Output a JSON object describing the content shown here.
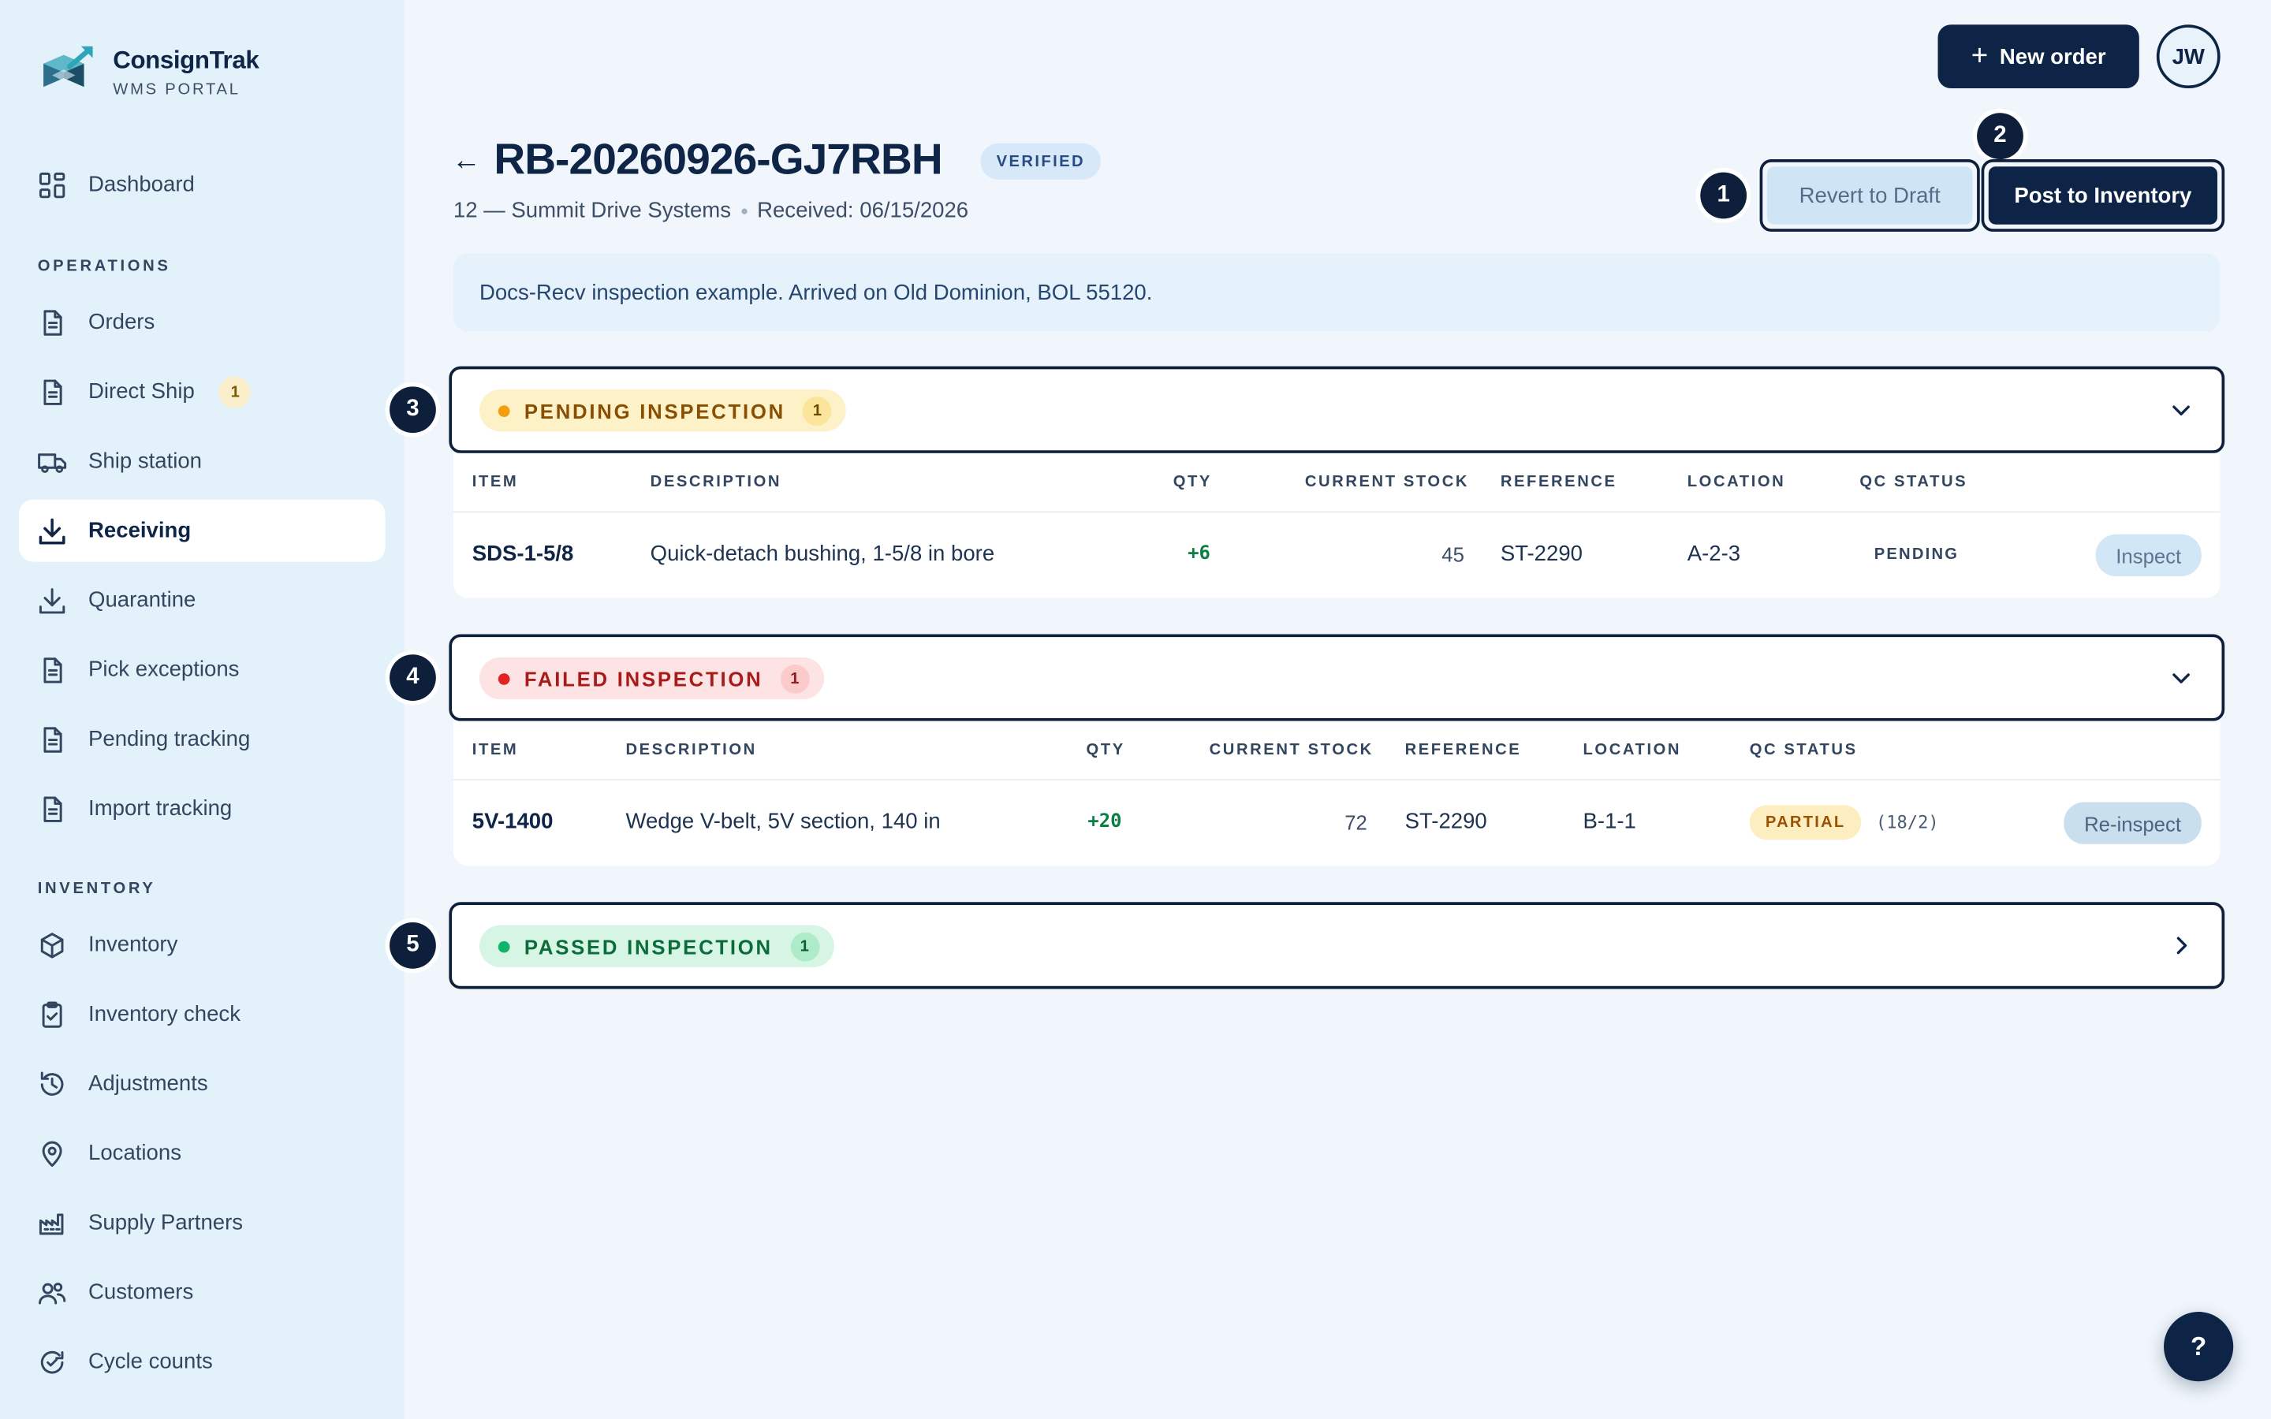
{
  "brand": {
    "name": "ConsignTrak",
    "subtitle": "WMS PORTAL"
  },
  "sidebar": {
    "dashboard": "Dashboard",
    "operations_label": "OPERATIONS",
    "operations": [
      {
        "label": "Orders",
        "icon": "document-icon"
      },
      {
        "label": "Direct Ship",
        "icon": "document-icon",
        "badge": "1"
      },
      {
        "label": "Ship station",
        "icon": "truck-icon"
      },
      {
        "label": "Receiving",
        "icon": "download-icon",
        "active": true
      },
      {
        "label": "Quarantine",
        "icon": "download-icon"
      },
      {
        "label": "Pick exceptions",
        "icon": "document-icon"
      },
      {
        "label": "Pending tracking",
        "icon": "document-icon"
      },
      {
        "label": "Import tracking",
        "icon": "document-icon"
      }
    ],
    "inventory_label": "INVENTORY",
    "inventory": [
      {
        "label": "Inventory",
        "icon": "box-icon"
      },
      {
        "label": "Inventory check",
        "icon": "clipboard-check-icon"
      },
      {
        "label": "Adjustments",
        "icon": "history-icon"
      },
      {
        "label": "Locations",
        "icon": "map-pin-icon"
      },
      {
        "label": "Supply Partners",
        "icon": "factory-icon"
      },
      {
        "label": "Customers",
        "icon": "users-icon"
      },
      {
        "label": "Cycle counts",
        "icon": "refresh-check-icon"
      }
    ]
  },
  "topbar": {
    "new_order": "New order",
    "avatar": "JW"
  },
  "header": {
    "title": "RB-20260926-GJ7RBH",
    "status": "VERIFIED",
    "customer": "12 — Summit Drive Systems",
    "received": "Received: 06/15/2026",
    "revert_label": "Revert to Draft",
    "post_label": "Post to Inventory"
  },
  "markers": [
    "1",
    "2",
    "3",
    "4",
    "5"
  ],
  "note": "Docs-Recv inspection example. Arrived on Old Dominion, BOL 55120.",
  "columns": {
    "item": "ITEM",
    "description": "DESCRIPTION",
    "qty": "QTY",
    "stock": "CURRENT STOCK",
    "reference": "REFERENCE",
    "location": "LOCATION",
    "qc": "QC STATUS"
  },
  "sections": {
    "pending": {
      "label": "PENDING INSPECTION",
      "count": "1",
      "row": {
        "item": "SDS-1-5/8",
        "description": "Quick-detach bushing, 1-5/8 in bore",
        "qty": "+6",
        "stock": "45",
        "reference": "ST-2290",
        "location": "A-2-3",
        "qc": "PENDING",
        "action": "Inspect"
      }
    },
    "failed": {
      "label": "FAILED INSPECTION",
      "count": "1",
      "row": {
        "item": "5V-1400",
        "description": "Wedge V-belt, 5V section, 140 in",
        "qty": "+20",
        "stock": "72",
        "reference": "ST-2290",
        "location": "B-1-1",
        "qc": "PARTIAL",
        "qc_note": "(18/2)",
        "action": "Re-inspect"
      }
    },
    "passed": {
      "label": "PASSED INSPECTION",
      "count": "1"
    }
  },
  "help": "?"
}
